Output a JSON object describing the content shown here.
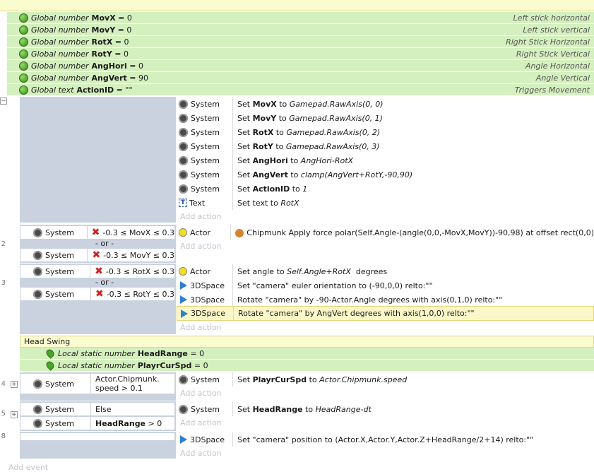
{
  "globals": [
    {
      "kind": "Global number",
      "name": "MovX",
      "op": " = ",
      "value": "0",
      "comment": "Left stick horizontal"
    },
    {
      "kind": "Global number",
      "name": "MovY",
      "op": " = ",
      "value": "0",
      "comment": "Left stick vertical"
    },
    {
      "kind": "Global number",
      "name": "RotX",
      "op": " = ",
      "value": "0",
      "comment": "Right Stick Horizontal"
    },
    {
      "kind": "Global number",
      "name": "RotY",
      "op": " = ",
      "value": "0",
      "comment": "Right Stick Vertical"
    },
    {
      "kind": "Global number",
      "name": "AngHori",
      "op": " = ",
      "value": "0",
      "comment": "Angle Horizontal"
    },
    {
      "kind": "Global number",
      "name": "AngVert",
      "op": " = ",
      "value": "90",
      "comment": "Angle Vertical"
    },
    {
      "kind": "Global text",
      "name": "ActionID",
      "op": " = ",
      "value": "\"\"",
      "comment": "Triggers Movement"
    }
  ],
  "event1": {
    "actions": [
      {
        "obj": "System",
        "pre": "Set ",
        "name": "MovX",
        "mid": " to ",
        "expr": "Gamepad.RawAxis(0, 0)"
      },
      {
        "obj": "System",
        "pre": "Set ",
        "name": "MovY",
        "mid": " to ",
        "expr": "Gamepad.RawAxis(0, 1)"
      },
      {
        "obj": "System",
        "pre": "Set ",
        "name": "RotX",
        "mid": " to ",
        "expr": "Gamepad.RawAxis(0, 2)"
      },
      {
        "obj": "System",
        "pre": "Set ",
        "name": "RotY",
        "mid": " to ",
        "expr": "Gamepad.RawAxis(0, 3)"
      },
      {
        "obj": "System",
        "pre": "Set ",
        "name": "AngHori",
        "mid": " to ",
        "expr": "AngHori-RotX"
      },
      {
        "obj": "System",
        "pre": "Set ",
        "name": "AngVert",
        "mid": " to ",
        "expr": "clamp(AngVert+RotY,-90,90)"
      },
      {
        "obj": "System",
        "pre": "Set ",
        "name": "ActionID",
        "mid": " to ",
        "expr": "1"
      },
      {
        "obj": "Text",
        "pre": "Set text to ",
        "name": "",
        "mid": "",
        "expr": "RotX"
      }
    ]
  },
  "add_action": "Add action",
  "add_event": "Add event",
  "or_label": "- or -",
  "event2": {
    "line": "2",
    "cond1": {
      "obj": "System",
      "text": "-0.3 ≤ MovX ≤ 0.3"
    },
    "cond2": {
      "obj": "System",
      "text": "-0.3 ≤ MovY ≤ 0.3"
    },
    "action": {
      "obj": "Actor",
      "text": "Chipmunk Apply force polar(Self.Angle-(angle(0,0,-MovX,MovY))-90,98) at offset rect(0,0)"
    }
  },
  "event3": {
    "line": "3",
    "cond1": {
      "obj": "System",
      "text": "-0.3 ≤ RotX ≤ 0.3"
    },
    "cond2": {
      "obj": "System",
      "text": "-0.3 ≤ RotY ≤ 0.3"
    },
    "a1": {
      "obj": "Actor",
      "pre": "Set angle to ",
      "expr": "Self.Angle+RotX",
      "post": "  degrees"
    },
    "a2": {
      "obj": "3DSpace",
      "text": "Set \"camera\" euler orientation to (-90,0,0) relto:\"\""
    },
    "a3": {
      "obj": "3DSpace",
      "text": "Rotate \"camera\" by -90-Actor.Angle degrees with axis(0,1,0) relto:\"\""
    },
    "a4": {
      "obj": "3DSpace",
      "text": "Rotate \"camera\" by AngVert degrees with axis(1,0,0) relto:\"\""
    }
  },
  "group": {
    "title": "Head Swing",
    "locals": [
      {
        "kind": "Local static number",
        "name": "HeadRange",
        "op": " = ",
        "value": "0"
      },
      {
        "kind": "Local static number",
        "name": "PlayrCurSpd",
        "op": " = ",
        "value": "0"
      }
    ]
  },
  "event4": {
    "line": "4",
    "expand": "+",
    "cond": {
      "obj": "System",
      "line1": "Actor.Chipmunk.",
      "line2": "speed > 0.1"
    },
    "action": {
      "obj": "System",
      "pre": "Set ",
      "name": "PlayrCurSpd",
      "mid": " to ",
      "expr": "Actor.Chipmunk.speed"
    }
  },
  "event5": {
    "line": "5",
    "expand": "+",
    "cond1": {
      "obj": "System",
      "text": "Else"
    },
    "cond2": {
      "obj": "System",
      "name": "HeadRange",
      "post": " > 0"
    },
    "action": {
      "obj": "System",
      "pre": "Set ",
      "name": "HeadRange",
      "mid": " to ",
      "expr": "HeadRange-dt"
    }
  },
  "event6": {
    "line": "8",
    "action": {
      "obj": "3DSpace",
      "text": "Set \"camera\" position to (Actor.X,Actor.Y,Actor.Z+HeadRange/2+14) relto:\"\""
    }
  },
  "collapse_symbol": "−"
}
